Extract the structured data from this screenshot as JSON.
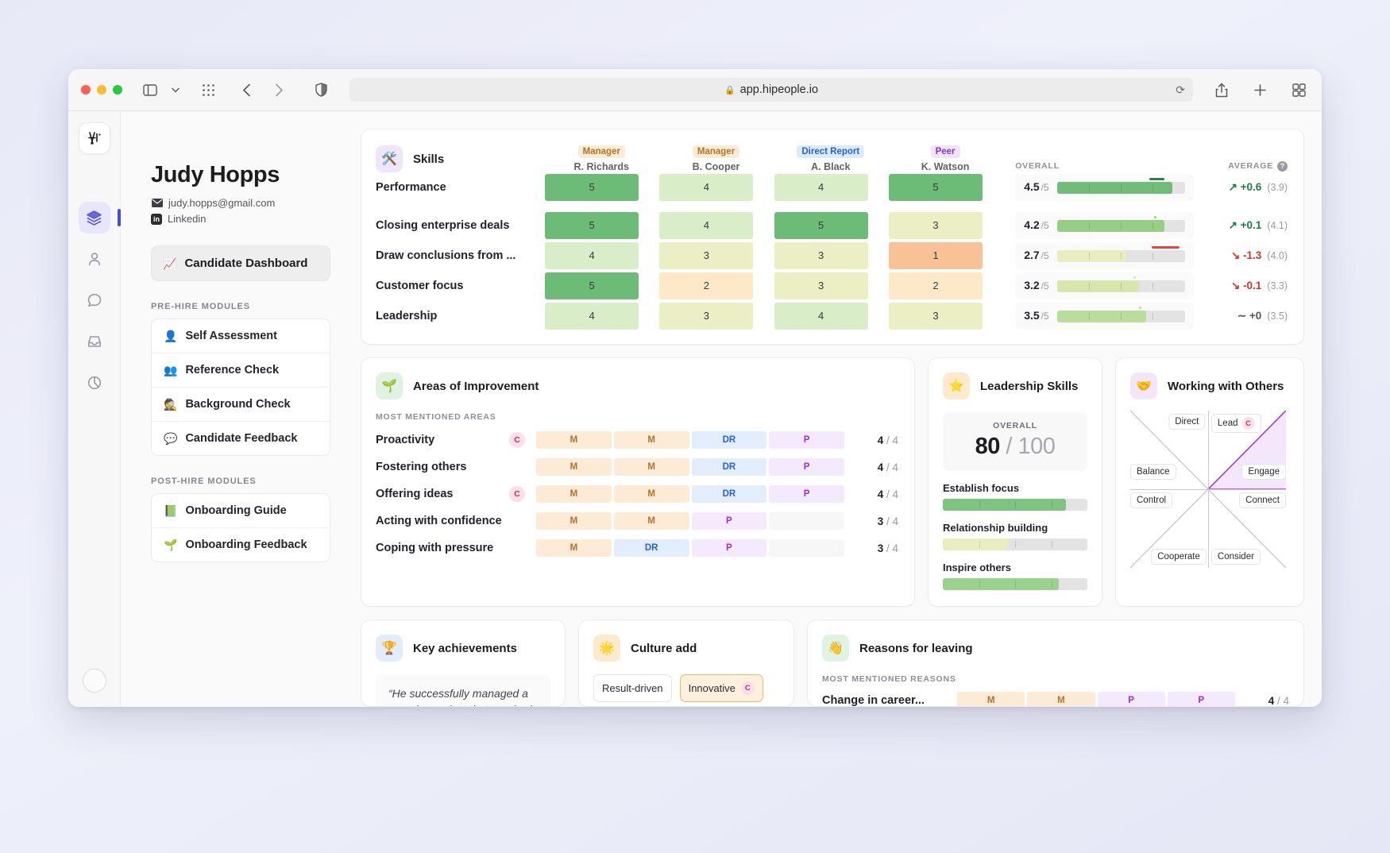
{
  "browser": {
    "url": "app.hipeople.io",
    "lock_icon": "lock-icon",
    "reload_icon": "reload-icon",
    "back_icon": "back-icon",
    "forward_icon": "forward-icon",
    "sidebar_icon": "sidebar-toggle-icon",
    "chevron_icon": "chevron-down-icon",
    "grid_icon": "apps-grid-icon",
    "shield_icon": "privacy-shield-icon",
    "share_icon": "share-icon",
    "newtab_icon": "new-tab-icon",
    "tabs_icon": "tab-overview-icon"
  },
  "rail": {
    "logo": "hipeople-logo",
    "items": [
      {
        "name": "layers-icon",
        "active": true
      },
      {
        "name": "person-icon",
        "active": false
      },
      {
        "name": "chat-bubble-icon",
        "active": false
      },
      {
        "name": "inbox-icon",
        "active": false
      },
      {
        "name": "pie-chart-icon",
        "active": false
      }
    ],
    "avatar": "user-avatar"
  },
  "profile": {
    "name": "Judy Hopps",
    "email": "judy.hopps@gmail.com",
    "linkedin": "Linkedin",
    "linkedin_badge": "in"
  },
  "sidebar": {
    "dashboard": {
      "label": "Candidate Dashboard",
      "emoji": "📈"
    },
    "prehire_title": "PRE-HIRE MODULES",
    "prehire": [
      {
        "label": "Self Assessment",
        "emoji": "👤"
      },
      {
        "label": "Reference Check",
        "emoji": "👥"
      },
      {
        "label": "Background Check",
        "emoji": "🕵️"
      },
      {
        "label": "Candidate Feedback",
        "emoji": "💬"
      }
    ],
    "posthire_title": "POST-HIRE MODULES",
    "posthire": [
      {
        "label": "Onboarding Guide",
        "emoji": "📗"
      },
      {
        "label": "Onboarding Feedback",
        "emoji": "🌱"
      }
    ]
  },
  "skills": {
    "title": "Skills",
    "emoji": "🛠️",
    "overall_header": "OVERALL",
    "average_header": "AVERAGE",
    "help_glyph": "?",
    "raters": [
      {
        "role": "Manager",
        "role_class": "role-manager",
        "name": "R. Richards"
      },
      {
        "role": "Manager",
        "role_class": "role-manager",
        "name": "B. Cooper"
      },
      {
        "role": "Direct Report",
        "role_class": "role-dr",
        "name": "A. Black"
      },
      {
        "role": "Peer",
        "role_class": "role-peer",
        "name": "K. Watson"
      }
    ],
    "rows": [
      {
        "name": "Performance",
        "scores": [
          5,
          4,
          4,
          5
        ],
        "overall": "4.5",
        "den": "/5",
        "pct": 90,
        "fill": "#6fbd78",
        "marker_pct": 78,
        "marker_color": "#2e7d4f",
        "delta": "+0.6",
        "dir": "up",
        "base": "(3.9)"
      },
      {
        "name": "Closing enterprise deals",
        "scores": [
          5,
          4,
          5,
          3
        ],
        "overall": "4.2",
        "den": "/5",
        "pct": 84,
        "fill": "#97ce86",
        "marker_pct": 82,
        "marker_color": "#97ce86",
        "delta": "+0.1",
        "dir": "up",
        "base": "(4.1)"
      },
      {
        "name": "Draw conclusions from ...",
        "scores": [
          4,
          3,
          3,
          1
        ],
        "overall": "2.7",
        "den": "/5",
        "pct": 54,
        "fill": "#eaedc0",
        "marker_pct": 80,
        "marker_color": "#e04a3c",
        "delta": "-1.3",
        "dir": "down",
        "base": "(4.0)"
      },
      {
        "name": "Customer focus",
        "scores": [
          5,
          2,
          3,
          2
        ],
        "overall": "3.2",
        "den": "/5",
        "pct": 64,
        "fill": "#d6e6ac",
        "marker_pct": 66,
        "marker_color": "#d6e6ac",
        "delta": "-0.1",
        "dir": "down",
        "base": "(3.3)"
      },
      {
        "name": "Leadership",
        "scores": [
          4,
          3,
          4,
          3
        ],
        "overall": "3.5",
        "den": "/5",
        "pct": 70,
        "fill": "#b9dd9b",
        "marker_pct": 70,
        "marker_color": "#b9dd9b",
        "delta": "+0",
        "dir": "flat",
        "base": "(3.5)"
      }
    ],
    "cell_colors": {
      "5": "#6cbb77",
      "4": "#d8edc8",
      "3": "#ecefc4",
      "2": "#fde9c7",
      "1": "#f8c296"
    }
  },
  "areas_of_improvement": {
    "title": "Areas of Improvement",
    "emoji": "🌱",
    "subtitle": "MOST MENTIONED AREAS",
    "rows": [
      {
        "name": "Proactivity",
        "candidate": "C",
        "tags": [
          "M",
          "M",
          "DR",
          "P"
        ],
        "count": "4",
        "total": "/ 4"
      },
      {
        "name": "Fostering others",
        "candidate": "",
        "tags": [
          "M",
          "M",
          "DR",
          "P"
        ],
        "count": "4",
        "total": "/ 4"
      },
      {
        "name": "Offering ideas",
        "candidate": "C",
        "tags": [
          "M",
          "M",
          "DR",
          "P"
        ],
        "count": "4",
        "total": "/ 4"
      },
      {
        "name": "Acting with confidence",
        "candidate": "",
        "tags": [
          "M",
          "M",
          "P",
          ""
        ],
        "count": "3",
        "total": "/ 4"
      },
      {
        "name": "Coping with pressure",
        "candidate": "",
        "tags": [
          "M",
          "DR",
          "P",
          ""
        ],
        "count": "3",
        "total": "/ 4"
      }
    ]
  },
  "leadership_skills": {
    "title": "Leadership Skills",
    "emoji": "⭐",
    "overall_label": "OVERALL",
    "score": "80",
    "score_den": "/ 100",
    "bars": [
      {
        "label": "Establish focus",
        "pct": 85,
        "color": "#7cc47f"
      },
      {
        "label": "Relationship building",
        "pct": 45,
        "color": "#eaedc0"
      },
      {
        "label": "Inspire others",
        "pct": 80,
        "color": "#9ad18c"
      }
    ]
  },
  "working_with_others": {
    "title": "Working with Others",
    "emoji": "🤝",
    "labels": [
      {
        "text": "Direct",
        "chip": ""
      },
      {
        "text": "Lead",
        "chip": "C"
      },
      {
        "text": "Balance",
        "chip": ""
      },
      {
        "text": "Engage",
        "chip": ""
      },
      {
        "text": "Control",
        "chip": ""
      },
      {
        "text": "Connect",
        "chip": ""
      },
      {
        "text": "Cooperate",
        "chip": ""
      },
      {
        "text": "Consider",
        "chip": ""
      }
    ],
    "accent": "#9b3fd4"
  },
  "key_achievements": {
    "title": "Key achievements",
    "emoji": "🏆",
    "quote": "“He successfully managed a complex project that required a"
  },
  "culture_add": {
    "title": "Culture add",
    "emoji": "🌟",
    "tags": [
      {
        "text": "Result-driven",
        "chip": "",
        "highlight": false
      },
      {
        "text": "Innovative",
        "chip": "C",
        "highlight": true
      }
    ]
  },
  "reasons_for_leaving": {
    "title": "Reasons for leaving",
    "emoji": "👋",
    "subtitle": "MOST MENTIONED REASONS",
    "rows": [
      {
        "name": "Change in career...",
        "tags": [
          "M",
          "M",
          "P",
          "P"
        ],
        "count": "4",
        "total": "/ 4"
      }
    ]
  }
}
